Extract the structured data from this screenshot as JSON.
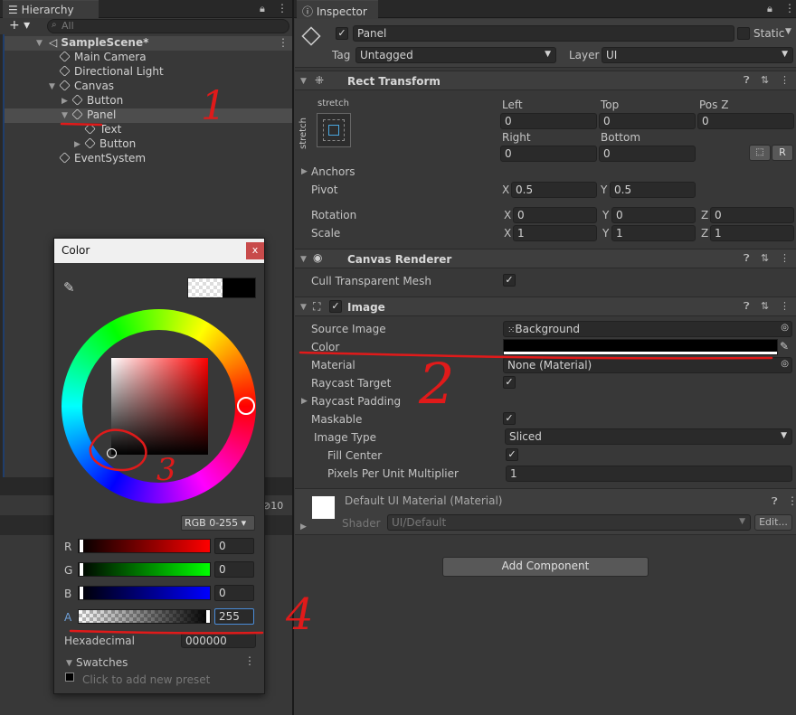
{
  "hierarchy": {
    "tab_label": "Hierarchy",
    "search_placeholder": "All",
    "add_label": "+ ▾",
    "scene_name": "SampleScene*",
    "items": [
      {
        "label": "Main Camera"
      },
      {
        "label": "Directional Light"
      },
      {
        "label": "Canvas"
      },
      {
        "label": "Button"
      },
      {
        "label": "Panel"
      },
      {
        "label": "Text"
      },
      {
        "label": "Button"
      },
      {
        "label": "EventSystem"
      }
    ],
    "count_badge": "10"
  },
  "inspector": {
    "tab_label": "Inspector",
    "object_name": "Panel",
    "static_label": "Static",
    "tag_label": "Tag",
    "tag_value": "Untagged",
    "layer_label": "Layer",
    "layer_value": "UI",
    "rect_transform": {
      "title": "Rect Transform",
      "anchor_preset_top": "stretch",
      "anchor_preset_side": "stretch",
      "left_label": "Left",
      "left_value": "0",
      "top_label": "Top",
      "top_value": "0",
      "posz_label": "Pos Z",
      "posz_value": "0",
      "right_label": "Right",
      "right_value": "0",
      "bottom_label": "Bottom",
      "bottom_value": "0",
      "r_button": "R",
      "anchors_label": "Anchors",
      "pivot_label": "Pivot",
      "pivot_x": "0.5",
      "pivot_y": "0.5",
      "rotation_label": "Rotation",
      "rot_x": "0",
      "rot_y": "0",
      "rot_z": "0",
      "scale_label": "Scale",
      "scale_x": "1",
      "scale_y": "1",
      "scale_z": "1",
      "x": "X",
      "y": "Y",
      "z": "Z"
    },
    "canvas_renderer": {
      "title": "Canvas Renderer",
      "cull_label": "Cull Transparent Mesh"
    },
    "image": {
      "title": "Image",
      "source_label": "Source Image",
      "source_value": "Background",
      "color_label": "Color",
      "material_label": "Material",
      "material_value": "None (Material)",
      "raycast_target_label": "Raycast Target",
      "raycast_padding_label": "Raycast Padding",
      "maskable_label": "Maskable",
      "image_type_label": "Image Type",
      "image_type_value": "Sliced",
      "fill_center_label": "Fill Center",
      "ppu_label": "Pixels Per Unit Multiplier",
      "ppu_value": "1"
    },
    "material_preview": {
      "title": "Default UI Material (Material)",
      "shader_label": "Shader",
      "shader_value": "UI/Default",
      "edit_label": "Edit..."
    },
    "add_component_label": "Add Component"
  },
  "color_picker": {
    "title": "Color",
    "close_label": "x",
    "mode_label": "RGB 0-255 ▾",
    "r_label": "R",
    "r_value": "0",
    "g_label": "G",
    "g_value": "0",
    "b_label": "B",
    "b_value": "0",
    "a_label": "A",
    "a_value": "255",
    "hex_label": "Hexadecimal",
    "hex_value": "000000",
    "swatches_label": "Swatches",
    "add_preset_label": "Click to add new preset"
  },
  "annotations": [
    "1",
    "2",
    "3",
    "4"
  ],
  "colors": {
    "accent": "#e01a1a",
    "selected_row": "#4d4d4d",
    "panel": "#383838"
  }
}
